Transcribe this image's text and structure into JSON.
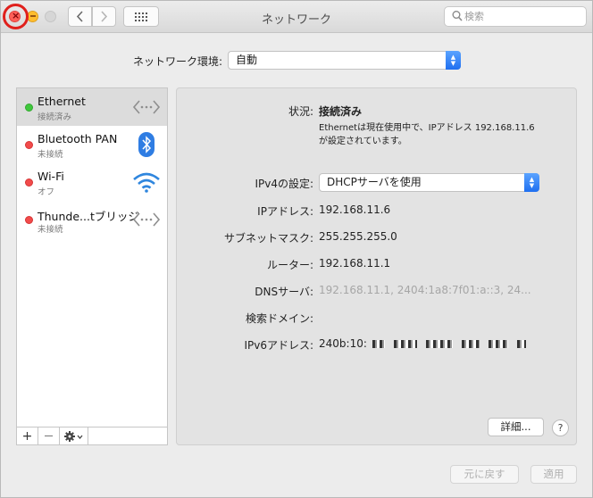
{
  "window": {
    "title": "ネットワーク",
    "search_placeholder": "検索"
  },
  "location": {
    "label": "ネットワーク環境:",
    "value": "自動"
  },
  "services": [
    {
      "name": "Ethernet",
      "status": "接続済み",
      "dot": "green",
      "icon": "ethernet-arrows-icon",
      "selected": true
    },
    {
      "name": "Bluetooth PAN",
      "status": "未接続",
      "dot": "red",
      "icon": "bluetooth-icon"
    },
    {
      "name": "Wi-Fi",
      "status": "オフ",
      "dot": "red",
      "icon": "wifi-icon"
    },
    {
      "name": "Thunde...tブリッジ",
      "status": "未接続",
      "dot": "red",
      "icon": "thunderbolt-bridge-arrows-icon"
    }
  ],
  "sidebar_buttons": {
    "add": "+",
    "remove": "—"
  },
  "detail": {
    "status_label": "状況:",
    "status_value": "接続済み",
    "status_desc_line1": "Ethernetは現在使用中で、IPアドレス 192.168.11.6",
    "status_desc_line2": "が設定されています。",
    "ipv4_label": "IPv4の設定:",
    "ipv4_value": "DHCPサーバを使用",
    "ip_label": "IPアドレス:",
    "ip_value": "192.168.11.6",
    "subnet_label": "サブネットマスク:",
    "subnet_value": "255.255.255.0",
    "router_label": "ルーター:",
    "router_value": "192.168.11.1",
    "dns_label": "DNSサーバ:",
    "dns_value": "192.168.11.1, 2404:1a8:7f01:a::3, 24...",
    "search_domain_label": "検索ドメイン:",
    "ipv6_label": "IPv6アドレス:",
    "ipv6_value": "240b:10:"
  },
  "buttons": {
    "advanced": "詳細...",
    "help": "?",
    "revert": "元に戻す",
    "apply": "適用"
  },
  "colors": {
    "connected": "#3fc83c",
    "disconnected": "#f24b4b",
    "popup_accent": "#1f6ff0",
    "highlight_ring": "#e0201c"
  }
}
